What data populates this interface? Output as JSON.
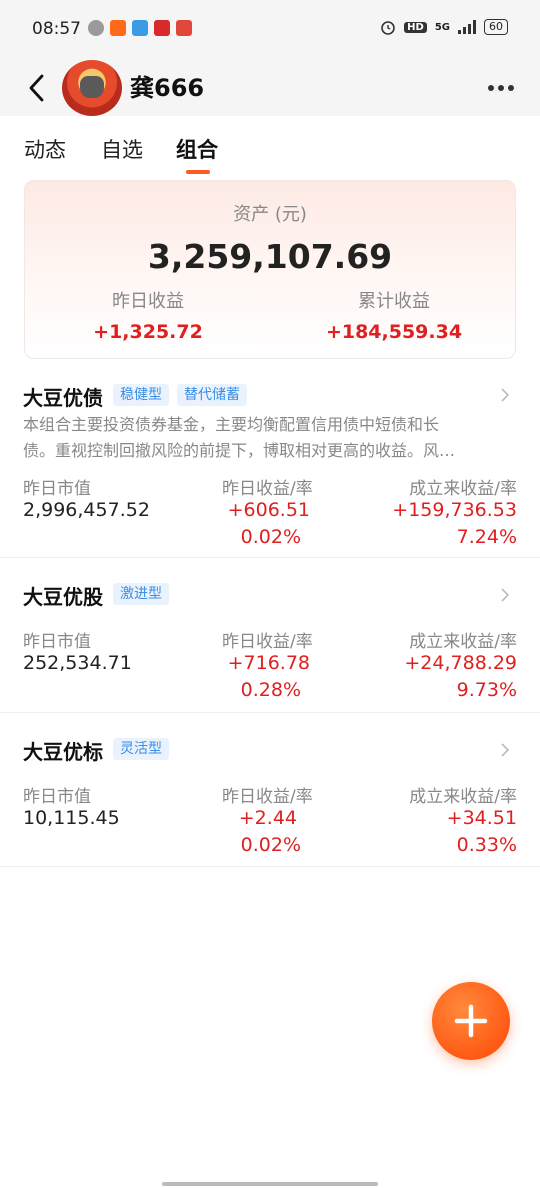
{
  "status_bar": {
    "time": "08:57",
    "network": "5G",
    "battery": "60",
    "hd_label": "HD"
  },
  "header": {
    "username": "龚666"
  },
  "tabs": [
    {
      "label": "动态",
      "active": false
    },
    {
      "label": "自选",
      "active": false
    },
    {
      "label": "组合",
      "active": true
    }
  ],
  "asset_card": {
    "label": "资产 (元)",
    "total": "3,259,107.69",
    "yesterday_label": "昨日收益",
    "yesterday_value": "+1,325.72",
    "cumulative_label": "累计收益",
    "cumulative_value": "+184,559.34"
  },
  "columns": {
    "market_value": "昨日市值",
    "yesterday_return": "昨日收益/率",
    "since_inception": "成立来收益/率"
  },
  "portfolios": [
    {
      "name": "大豆优债",
      "tags": [
        "稳健型",
        "替代储蓄"
      ],
      "description_line1": "本组合主要投资债券基金，主要均衡配置信用债中短债和长",
      "description_line2": "债。重视控制回撤风险的前提下，博取相对更高的收益。风…",
      "market_value": "2,996,457.52",
      "yesterday_gain": "+606.51",
      "yesterday_rate": "0.02%",
      "total_gain": "+159,736.53",
      "total_rate": "7.24%"
    },
    {
      "name": "大豆优股",
      "tags": [
        "激进型"
      ],
      "market_value": "252,534.71",
      "yesterday_gain": "+716.78",
      "yesterday_rate": "0.28%",
      "total_gain": "+24,788.29",
      "total_rate": "9.73%"
    },
    {
      "name": "大豆优标",
      "tags": [
        "灵活型"
      ],
      "market_value": "10,115.45",
      "yesterday_gain": "+2.44",
      "yesterday_rate": "0.02%",
      "total_gain": "+34.51",
      "total_rate": "0.33%"
    }
  ],
  "colors": {
    "gain_red": "#e02020",
    "accent_orange": "#ff5a1f",
    "tag_blue": "#3a8ee6"
  },
  "icons": {
    "back": "back-arrow-icon",
    "more": "more-dots-icon",
    "chevron": "chevron-right-icon",
    "add": "plus-icon"
  }
}
